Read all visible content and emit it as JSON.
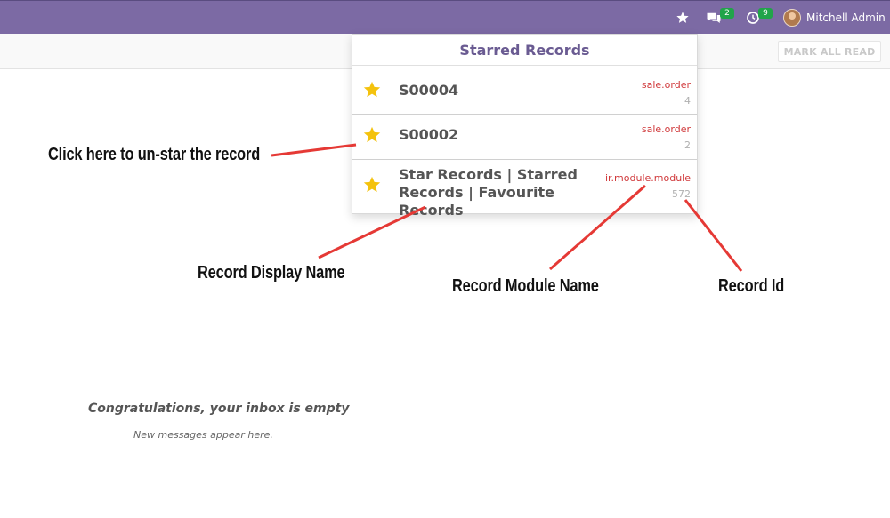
{
  "navbar": {
    "chat_badge": "2",
    "activity_badge": "9",
    "user_name": "Mitchell Admin",
    "bg_color": "#7c6aa4",
    "icons": [
      "star-icon",
      "chat-icon",
      "clock-icon",
      "avatar"
    ]
  },
  "control_panel": {
    "mark_all_read": "MARK ALL READ"
  },
  "starred_dropdown": {
    "title": "Starred Records",
    "records": [
      {
        "name": "S00004",
        "model": "sale.order",
        "id": "4"
      },
      {
        "name": "S00002",
        "model": "sale.order",
        "id": "2"
      },
      {
        "name_line1": "Star Records | Starred",
        "name_line2": "Records | Favourite Records",
        "model": "ir.module.module",
        "id": "572"
      }
    ],
    "star_color": "#f4c20d",
    "model_color": "#d0393b"
  },
  "annotations": {
    "unstar": "Click here to un-star the record",
    "display_name": "Record Display Name",
    "module_name": "Record Module Name",
    "record_id": "Record Id",
    "arrow_color": "#e53935"
  },
  "inbox": {
    "empty_title": "Congratulations, your inbox is empty",
    "empty_subtitle": "New messages appear here."
  }
}
